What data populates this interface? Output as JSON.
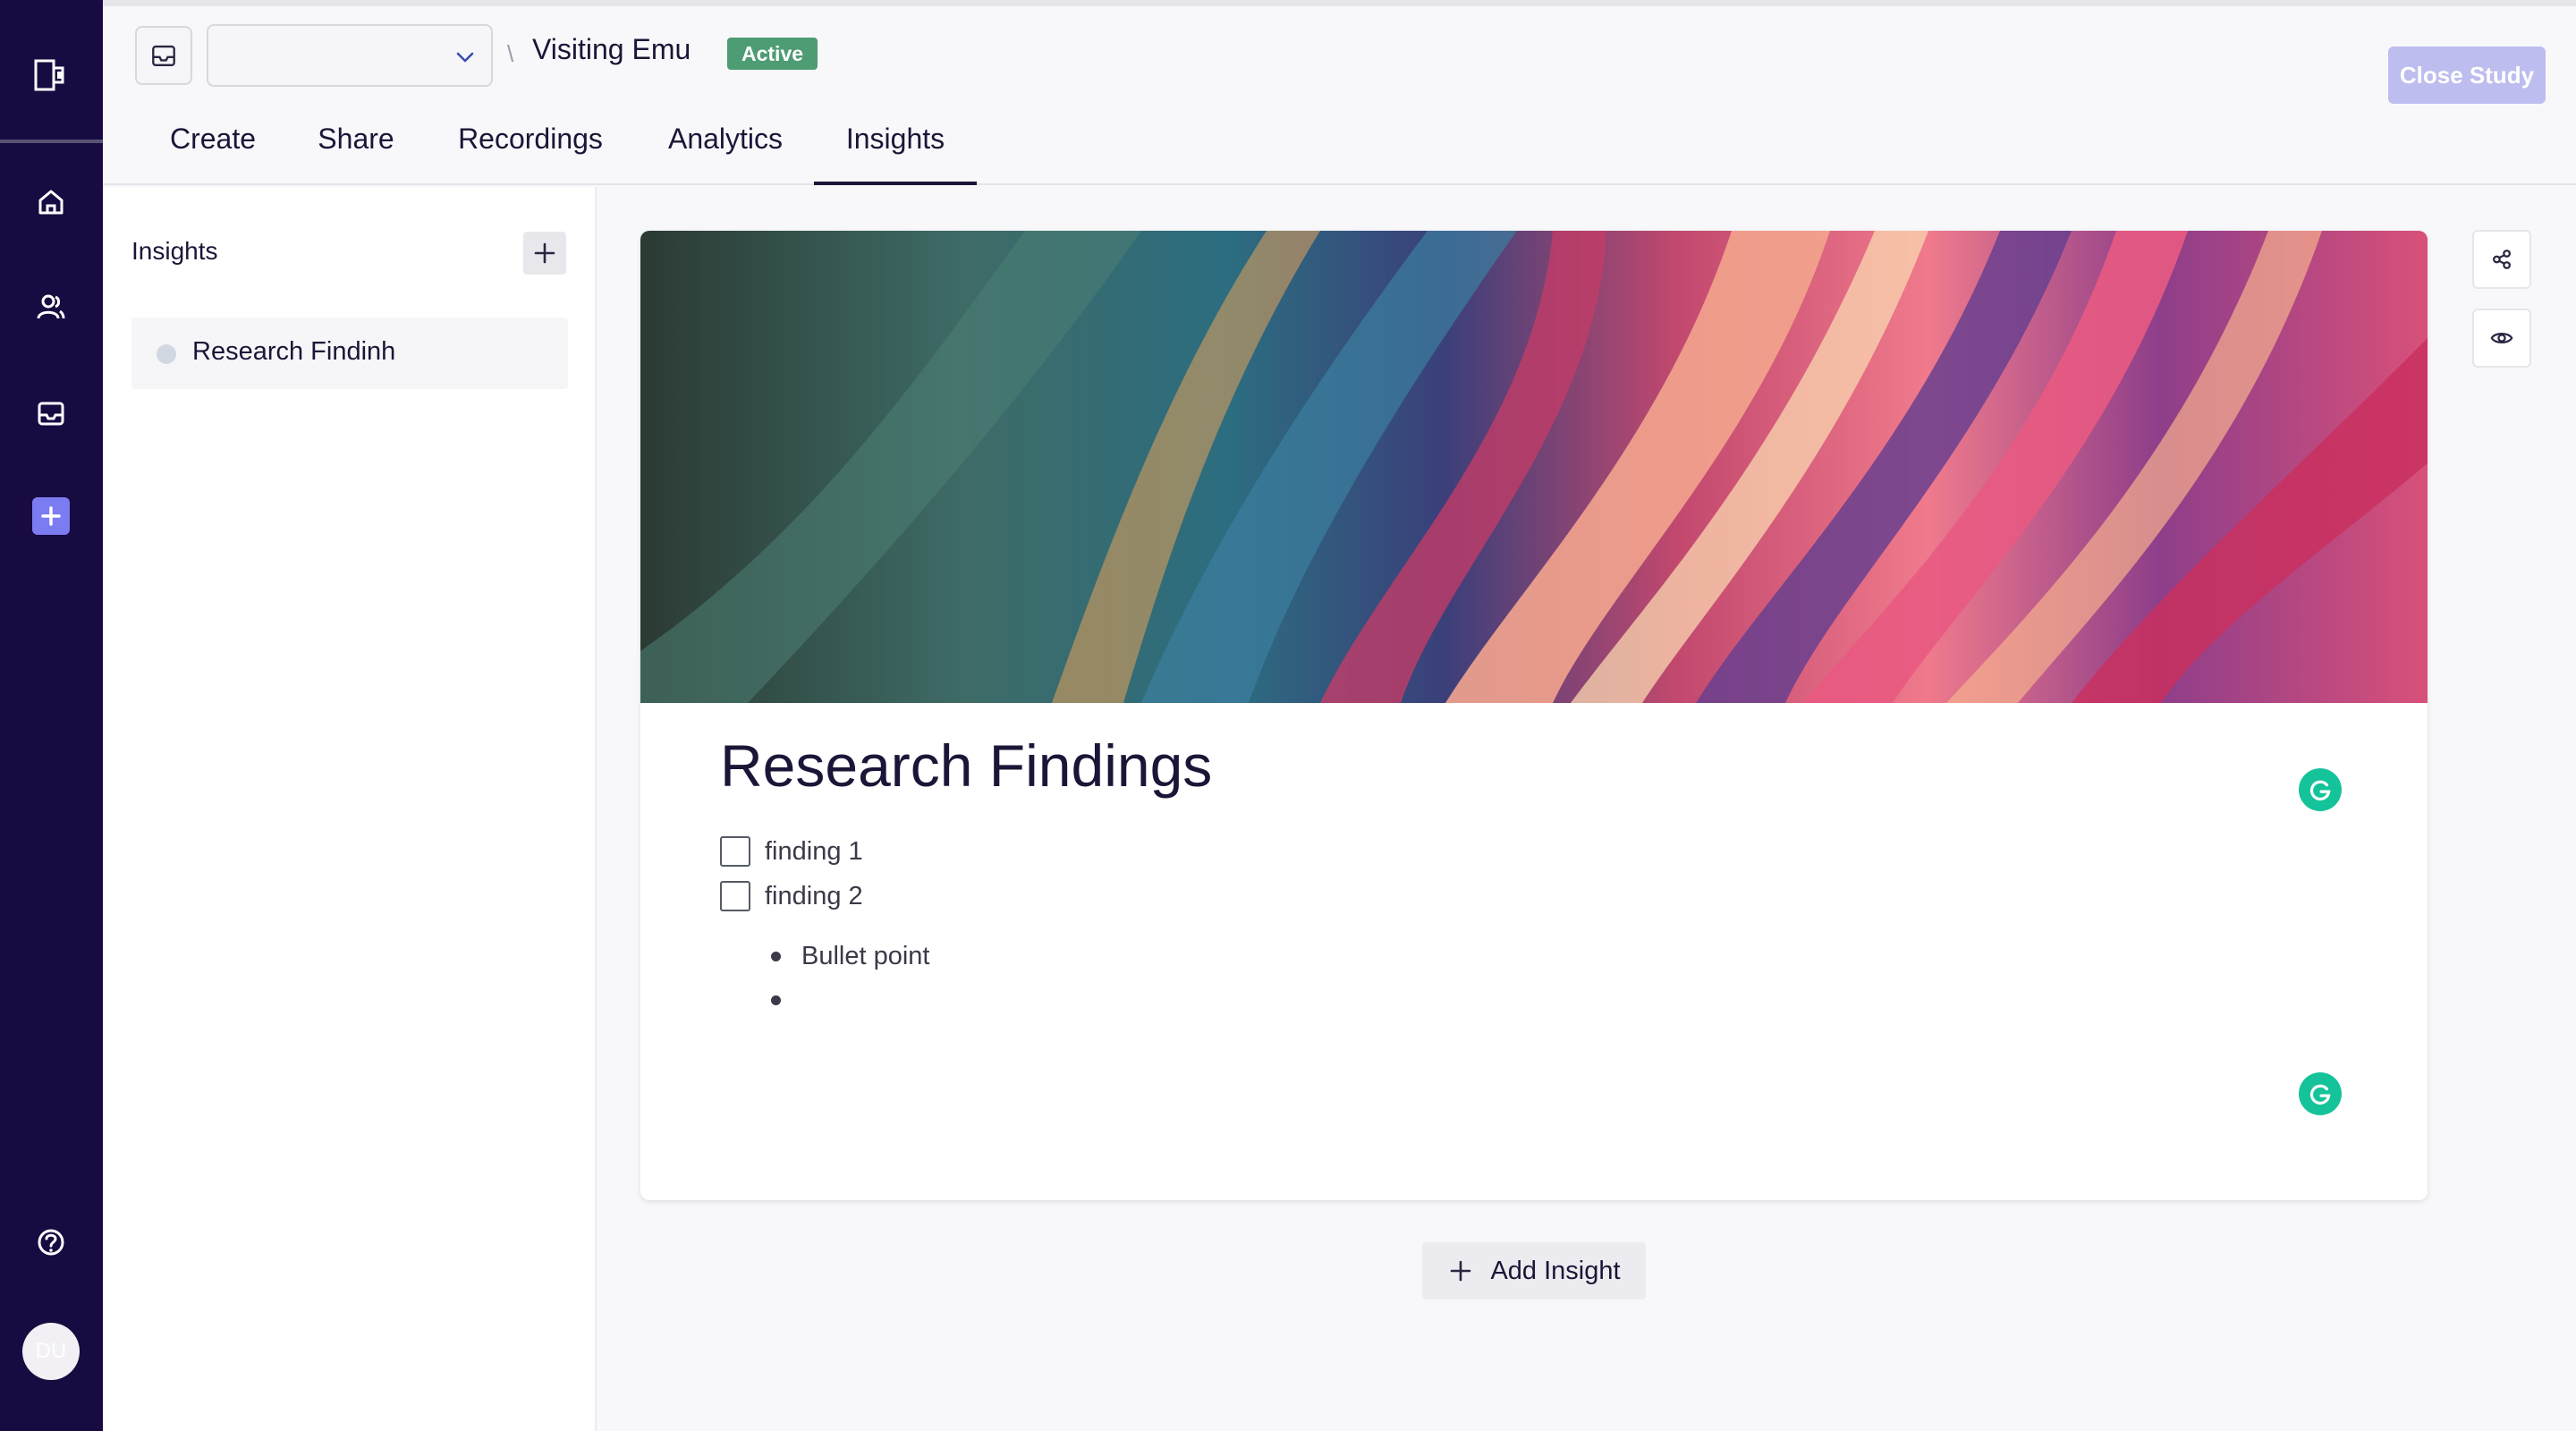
{
  "header": {
    "breadcrumb_separator": "\\",
    "study_title": "Visiting Emu",
    "status_badge": "Active",
    "close_study_label": "Close Study",
    "select_value": ""
  },
  "tabs": [
    {
      "label": "Create"
    },
    {
      "label": "Share"
    },
    {
      "label": "Recordings"
    },
    {
      "label": "Analytics"
    },
    {
      "label": "Insights"
    }
  ],
  "active_tab": "Insights",
  "sidebar": {
    "title": "Insights",
    "items": [
      {
        "label": "Research Findinh"
      }
    ]
  },
  "document": {
    "title": "Research Findings",
    "checklist": [
      {
        "label": "finding 1",
        "checked": false
      },
      {
        "label": "finding 2",
        "checked": false
      }
    ],
    "bullets": [
      "Bullet point",
      ""
    ]
  },
  "actions": {
    "add_insight_label": "Add Insight"
  },
  "user": {
    "initials": "DU"
  },
  "colors": {
    "rail": "#180b41",
    "accent": "#7c7cf2",
    "badge": "#4d9c74",
    "close_study": "#bdbdef",
    "grammarly": "#15c39a"
  },
  "icons": {
    "rail": [
      "app-logo-icon",
      "home-icon",
      "users-icon",
      "inbox-icon",
      "plus-icon",
      "help-icon"
    ],
    "side": [
      "share-icon",
      "eye-icon"
    ]
  }
}
